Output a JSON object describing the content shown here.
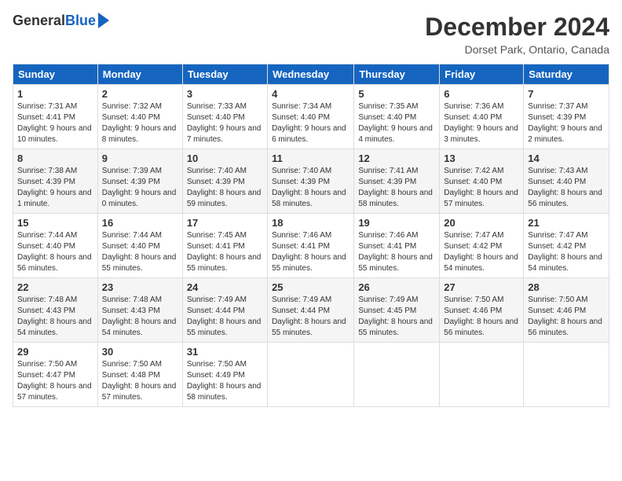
{
  "header": {
    "logo_general": "General",
    "logo_blue": "Blue",
    "month_title": "December 2024",
    "location": "Dorset Park, Ontario, Canada"
  },
  "days_of_week": [
    "Sunday",
    "Monday",
    "Tuesday",
    "Wednesday",
    "Thursday",
    "Friday",
    "Saturday"
  ],
  "weeks": [
    [
      {
        "day": "1",
        "sunrise": "7:31 AM",
        "sunset": "4:41 PM",
        "daylight": "9 hours and 10 minutes."
      },
      {
        "day": "2",
        "sunrise": "7:32 AM",
        "sunset": "4:40 PM",
        "daylight": "9 hours and 8 minutes."
      },
      {
        "day": "3",
        "sunrise": "7:33 AM",
        "sunset": "4:40 PM",
        "daylight": "9 hours and 7 minutes."
      },
      {
        "day": "4",
        "sunrise": "7:34 AM",
        "sunset": "4:40 PM",
        "daylight": "9 hours and 6 minutes."
      },
      {
        "day": "5",
        "sunrise": "7:35 AM",
        "sunset": "4:40 PM",
        "daylight": "9 hours and 4 minutes."
      },
      {
        "day": "6",
        "sunrise": "7:36 AM",
        "sunset": "4:40 PM",
        "daylight": "9 hours and 3 minutes."
      },
      {
        "day": "7",
        "sunrise": "7:37 AM",
        "sunset": "4:39 PM",
        "daylight": "9 hours and 2 minutes."
      }
    ],
    [
      {
        "day": "8",
        "sunrise": "7:38 AM",
        "sunset": "4:39 PM",
        "daylight": "9 hours and 1 minute."
      },
      {
        "day": "9",
        "sunrise": "7:39 AM",
        "sunset": "4:39 PM",
        "daylight": "9 hours and 0 minutes."
      },
      {
        "day": "10",
        "sunrise": "7:40 AM",
        "sunset": "4:39 PM",
        "daylight": "8 hours and 59 minutes."
      },
      {
        "day": "11",
        "sunrise": "7:40 AM",
        "sunset": "4:39 PM",
        "daylight": "8 hours and 58 minutes."
      },
      {
        "day": "12",
        "sunrise": "7:41 AM",
        "sunset": "4:39 PM",
        "daylight": "8 hours and 58 minutes."
      },
      {
        "day": "13",
        "sunrise": "7:42 AM",
        "sunset": "4:40 PM",
        "daylight": "8 hours and 57 minutes."
      },
      {
        "day": "14",
        "sunrise": "7:43 AM",
        "sunset": "4:40 PM",
        "daylight": "8 hours and 56 minutes."
      }
    ],
    [
      {
        "day": "15",
        "sunrise": "7:44 AM",
        "sunset": "4:40 PM",
        "daylight": "8 hours and 56 minutes."
      },
      {
        "day": "16",
        "sunrise": "7:44 AM",
        "sunset": "4:40 PM",
        "daylight": "8 hours and 55 minutes."
      },
      {
        "day": "17",
        "sunrise": "7:45 AM",
        "sunset": "4:41 PM",
        "daylight": "8 hours and 55 minutes."
      },
      {
        "day": "18",
        "sunrise": "7:46 AM",
        "sunset": "4:41 PM",
        "daylight": "8 hours and 55 minutes."
      },
      {
        "day": "19",
        "sunrise": "7:46 AM",
        "sunset": "4:41 PM",
        "daylight": "8 hours and 55 minutes."
      },
      {
        "day": "20",
        "sunrise": "7:47 AM",
        "sunset": "4:42 PM",
        "daylight": "8 hours and 54 minutes."
      },
      {
        "day": "21",
        "sunrise": "7:47 AM",
        "sunset": "4:42 PM",
        "daylight": "8 hours and 54 minutes."
      }
    ],
    [
      {
        "day": "22",
        "sunrise": "7:48 AM",
        "sunset": "4:43 PM",
        "daylight": "8 hours and 54 minutes."
      },
      {
        "day": "23",
        "sunrise": "7:48 AM",
        "sunset": "4:43 PM",
        "daylight": "8 hours and 54 minutes."
      },
      {
        "day": "24",
        "sunrise": "7:49 AM",
        "sunset": "4:44 PM",
        "daylight": "8 hours and 55 minutes."
      },
      {
        "day": "25",
        "sunrise": "7:49 AM",
        "sunset": "4:44 PM",
        "daylight": "8 hours and 55 minutes."
      },
      {
        "day": "26",
        "sunrise": "7:49 AM",
        "sunset": "4:45 PM",
        "daylight": "8 hours and 55 minutes."
      },
      {
        "day": "27",
        "sunrise": "7:50 AM",
        "sunset": "4:46 PM",
        "daylight": "8 hours and 56 minutes."
      },
      {
        "day": "28",
        "sunrise": "7:50 AM",
        "sunset": "4:46 PM",
        "daylight": "8 hours and 56 minutes."
      }
    ],
    [
      {
        "day": "29",
        "sunrise": "7:50 AM",
        "sunset": "4:47 PM",
        "daylight": "8 hours and 57 minutes."
      },
      {
        "day": "30",
        "sunrise": "7:50 AM",
        "sunset": "4:48 PM",
        "daylight": "8 hours and 57 minutes."
      },
      {
        "day": "31",
        "sunrise": "7:50 AM",
        "sunset": "4:49 PM",
        "daylight": "8 hours and 58 minutes."
      },
      null,
      null,
      null,
      null
    ]
  ]
}
